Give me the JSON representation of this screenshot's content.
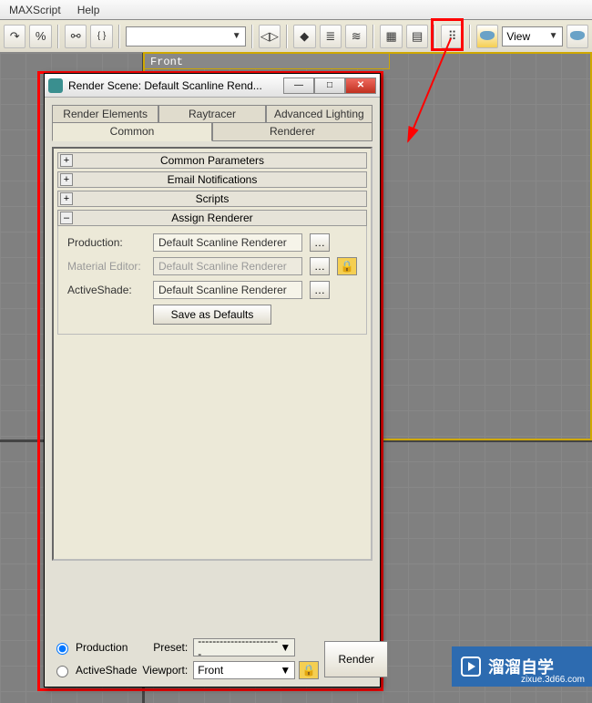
{
  "menu": {
    "maxscript": "MAXScript",
    "help": "Help"
  },
  "toolbar": {
    "view_label": "View"
  },
  "viewport": {
    "front_label": "Front"
  },
  "dialog": {
    "title": "Render Scene: Default Scanline Rend...",
    "tabs": {
      "render_elements": "Render Elements",
      "raytracer": "Raytracer",
      "advanced_lighting": "Advanced Lighting",
      "common": "Common",
      "renderer": "Renderer"
    },
    "rollouts": {
      "common_parameters": "Common Parameters",
      "email_notifications": "Email Notifications",
      "scripts": "Scripts",
      "assign_renderer": "Assign Renderer"
    },
    "assign": {
      "production_label": "Production:",
      "production_value": "Default Scanline Renderer",
      "material_label": "Material Editor:",
      "material_value": "Default Scanline Renderer",
      "activeshade_label": "ActiveShade:",
      "activeshade_value": "Default Scanline Renderer",
      "save_defaults": "Save as Defaults"
    },
    "bottom": {
      "production_radio": "Production",
      "activeshade_radio": "ActiveShade",
      "preset_label": "Preset:",
      "preset_value": "-----------------------",
      "viewport_label": "Viewport:",
      "viewport_value": "Front",
      "render_button": "Render"
    }
  },
  "watermark": {
    "text": "溜溜自学",
    "url": "zixue.3d66.com"
  }
}
